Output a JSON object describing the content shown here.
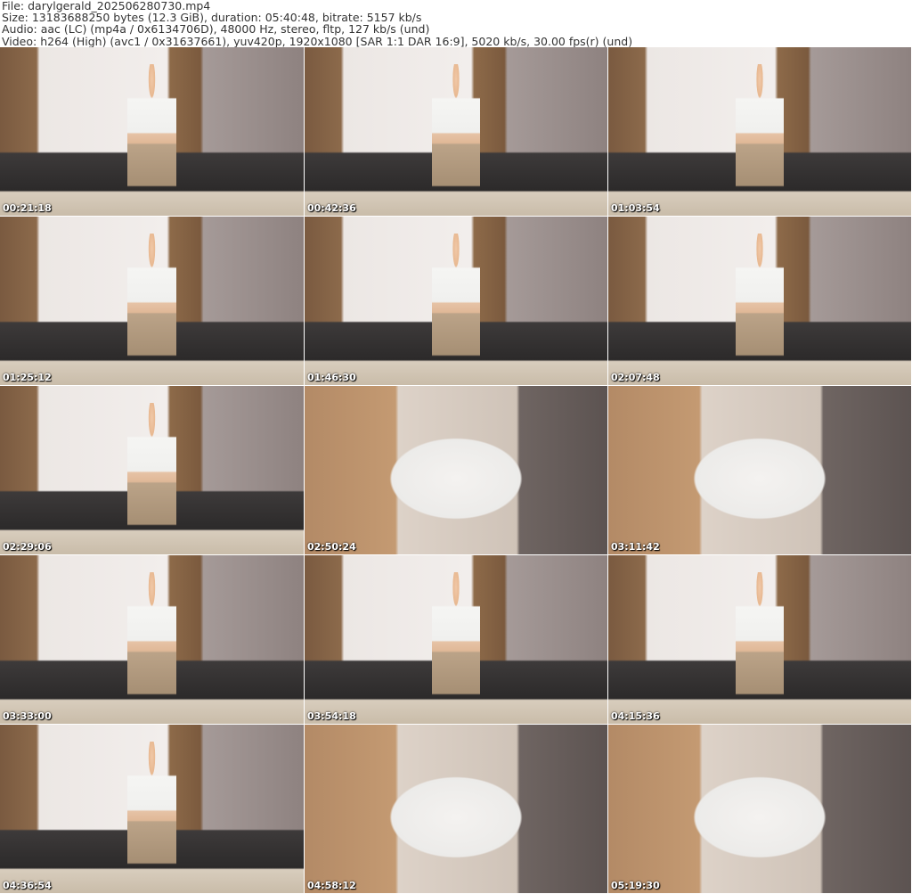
{
  "header": {
    "file": "File: darylgerald_202506280730.mp4",
    "size": "Size: 13183688250 bytes (12.3 GiB), duration: 05:40:48, bitrate: 5157 kb/s",
    "audio": "Audio: aac (LC) (mp4a / 0x6134706D), 48000 Hz, stereo, fltp, 127 kb/s (und)",
    "video": "Video: h264 (High) (avc1 / 0x31637661), yuv420p, 1920x1080 [SAR 1:1 DAR 16:9], 5020 kb/s, 30.00 fps(r) (und)"
  },
  "thumbnails": [
    {
      "timestamp": "00:21:18",
      "shot": "wide"
    },
    {
      "timestamp": "00:42:36",
      "shot": "wide"
    },
    {
      "timestamp": "01:03:54",
      "shot": "wide"
    },
    {
      "timestamp": "01:25:12",
      "shot": "wide"
    },
    {
      "timestamp": "01:46:30",
      "shot": "wide"
    },
    {
      "timestamp": "02:07:48",
      "shot": "wide"
    },
    {
      "timestamp": "02:29:06",
      "shot": "wide"
    },
    {
      "timestamp": "02:50:24",
      "shot": "close"
    },
    {
      "timestamp": "03:11:42",
      "shot": "close"
    },
    {
      "timestamp": "03:33:00",
      "shot": "wide"
    },
    {
      "timestamp": "03:54:18",
      "shot": "wide"
    },
    {
      "timestamp": "04:15:36",
      "shot": "wide"
    },
    {
      "timestamp": "04:36:54",
      "shot": "wide"
    },
    {
      "timestamp": "04:58:12",
      "shot": "close"
    },
    {
      "timestamp": "05:19:30",
      "shot": "close"
    }
  ]
}
